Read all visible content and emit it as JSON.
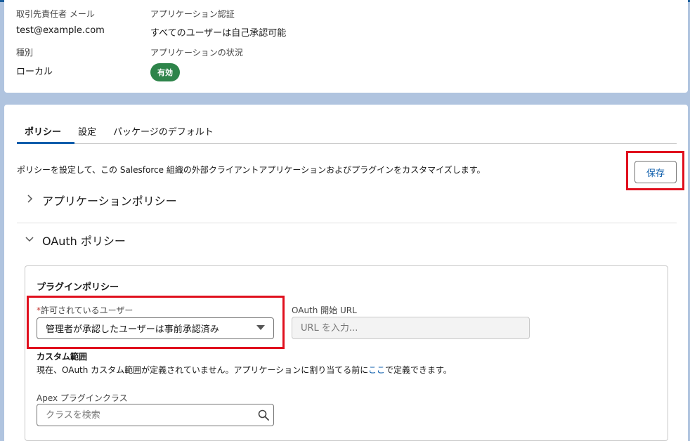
{
  "summary": {
    "contact_email_label": "取引先責任者 メール",
    "contact_email_value": "test@example.com",
    "app_auth_label": "アプリケーション認証",
    "app_auth_value": "すべてのユーザーは自己承認可能",
    "type_label": "種別",
    "type_value": "ローカル",
    "app_status_label": "アプリケーションの状況",
    "app_status_value": "有効"
  },
  "tabs": [
    {
      "label": "ポリシー",
      "active": true
    },
    {
      "label": "設定",
      "active": false
    },
    {
      "label": "パッケージのデフォルト",
      "active": false
    }
  ],
  "description": "ポリシーを設定して、この Salesforce 組織の外部クライアントアプリケーションおよびプラグインをカスタマイズします。",
  "save_label": "保存",
  "sections": {
    "app_policy": "アプリケーションポリシー",
    "oauth_policy": "OAuth ポリシー"
  },
  "plugin_policy": {
    "title": "プラグインポリシー",
    "permitted_users_label": "許可されているユーザー",
    "required_marker": "*",
    "permitted_users_value": "管理者が承認したユーザーは事前承認済み",
    "oauth_start_url_label": "OAuth 開始 URL",
    "oauth_start_url_placeholder": "URL を入力...",
    "custom_scope_title": "カスタム範囲",
    "custom_scope_text_before": "現在、OAuth カスタム範囲が定義されていません。アプリケーションに割り当てる前に",
    "custom_scope_link": "ここ",
    "custom_scope_text_after": "で定義できます。",
    "apex_plugin_class_label": "Apex プラグインクラス",
    "class_search_placeholder": "クラスを検索"
  },
  "colors": {
    "accent": "#0b5cab",
    "status_active": "#2e844a",
    "highlight": "#e0101e"
  }
}
